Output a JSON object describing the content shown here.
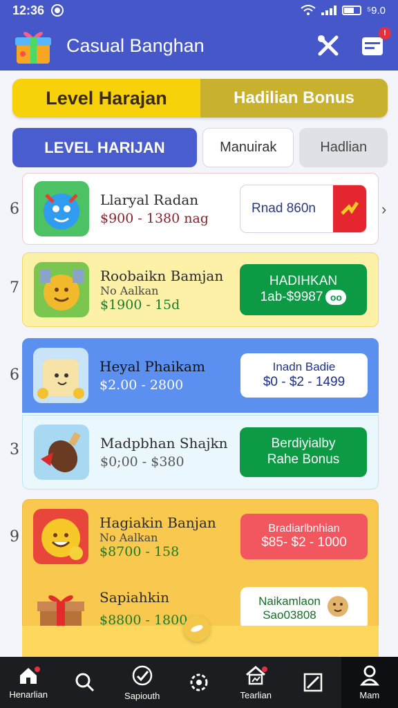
{
  "status": {
    "time": "12:36",
    "right_text": "⁵9.0"
  },
  "header": {
    "title": "Casual Banghan",
    "badge": "!"
  },
  "segment": {
    "left": "Level Harajan",
    "right": "Hadilian Bonus"
  },
  "tabs": [
    "LEVEL HARIJAN",
    "Manuirak",
    "Hadlian"
  ],
  "side_numbers": [
    "6",
    "7",
    "6",
    "3",
    "9"
  ],
  "cards": [
    {
      "name": "Llaryal Radan",
      "sub": "",
      "price": "$900 - 1380  nag",
      "cta": [
        "Rnad 860n"
      ]
    },
    {
      "name": "Roobaikn Bamjan",
      "sub": "No Aalkan",
      "price": "$1900 - 15d",
      "cta": [
        "HADIHKAN",
        "1ab-$9987"
      ]
    },
    {
      "name": "Heyal Phaikam",
      "sub": "",
      "price": "$2.00 - 2800",
      "cta": [
        "Inadn Badie",
        "$0 - $2 - 1499"
      ]
    },
    {
      "name": "Madpbhan Shajkn",
      "sub": "",
      "price": "$0;00 - $380",
      "cta": [
        "Berdiyialby",
        "Rahe Bonus"
      ]
    },
    {
      "name": "Hagiakin Banjan",
      "sub": "No Aalkan",
      "price": "$8700 - 158",
      "cta": [
        "Bradiarlbnhian",
        "$85- $2 - 1000"
      ]
    },
    {
      "name": "Sapiahkin",
      "sub": "",
      "price": "$8800 - 1800",
      "cta": [
        "Naikamlaon",
        "Sao03808"
      ]
    }
  ],
  "nav": [
    "Henarlian",
    "Sapiouth",
    "",
    "Tearlian",
    "",
    "Mam"
  ],
  "colors": {
    "primary": "#4658c9",
    "yellow": "#f7d20a",
    "green": "#0c9a45",
    "red": "#f2565f"
  }
}
